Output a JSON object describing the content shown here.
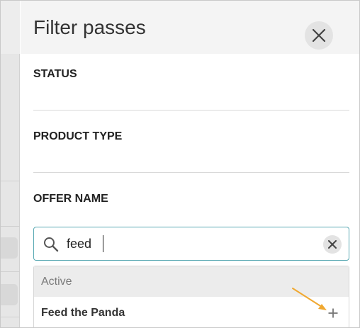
{
  "panel": {
    "title": "Filter passes"
  },
  "sections": {
    "status": {
      "title": "STATUS"
    },
    "product_type": {
      "title": "PRODUCT TYPE"
    },
    "offer_name": {
      "title": "OFFER NAME"
    }
  },
  "search": {
    "value": "feed"
  },
  "results": {
    "group_label": "Active",
    "items": [
      {
        "label": "Feed the Panda"
      }
    ]
  },
  "colors": {
    "accent_border": "#5aa9b3",
    "annotation_arrow": "#f0a830"
  },
  "icons": {
    "close": "close-icon",
    "search": "search-icon",
    "clear": "clear-icon",
    "add": "plus-icon"
  }
}
